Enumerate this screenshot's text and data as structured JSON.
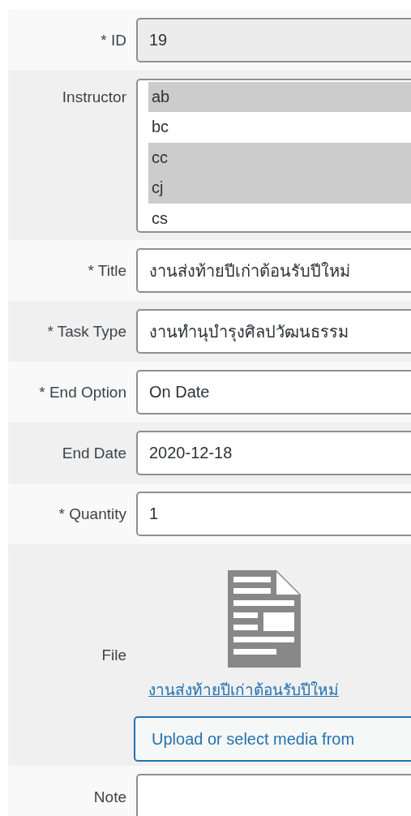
{
  "fields": [
    {
      "kind": "text",
      "label": "* ID",
      "value": "19",
      "disabled": true
    },
    {
      "kind": "multiselect",
      "label": "Instructor",
      "disabled": false,
      "options": [
        {
          "label": "ab",
          "selected": true
        },
        {
          "label": "bc",
          "selected": false
        },
        {
          "label": "cc",
          "selected": true
        },
        {
          "label": "cj",
          "selected": true
        },
        {
          "label": "cs",
          "selected": false
        }
      ]
    },
    {
      "kind": "text",
      "label": "* Title",
      "value": "งานส่งท้ายปีเก่าต้อนรับปีใหม่",
      "disabled": false
    },
    {
      "kind": "text",
      "label": "* Task Type",
      "value": "งานทำนุบำรุงศิลปวัฒนธรรม",
      "disabled": false
    },
    {
      "kind": "text",
      "label": "* End Option",
      "value": "On Date",
      "disabled": false
    },
    {
      "kind": "text",
      "label": "End Date",
      "value": "2020-12-18",
      "disabled": false
    },
    {
      "kind": "text",
      "label": "* Quantity",
      "value": "1",
      "disabled": false
    },
    {
      "kind": "file",
      "label": "File",
      "file_name": "งานส่งท้ายปีเก่าต้อนรับปีใหม่",
      "button": "Upload or select media from",
      "disabled": false
    },
    {
      "kind": "textarea",
      "label": "Note",
      "disabled": false
    }
  ]
}
